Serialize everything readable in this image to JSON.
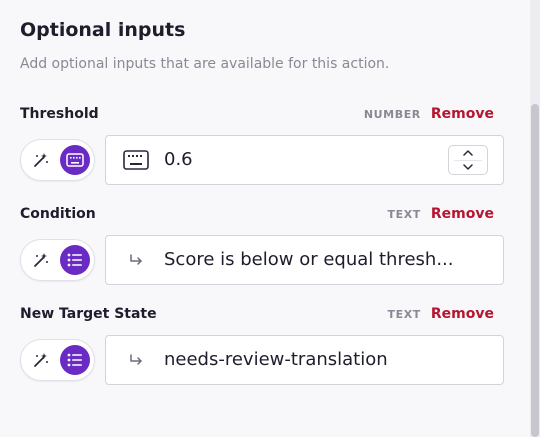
{
  "section": {
    "title": "Optional inputs",
    "subtitle": "Add optional inputs that are available for this action."
  },
  "remove_label": "Remove",
  "fields": [
    {
      "label": "Threshold",
      "type": "NUMBER",
      "value": "0.6",
      "mode_icons": [
        "magic-wand-icon",
        "keyboard-icon"
      ],
      "active_mode": "keyboard",
      "input_icon": "keyboard-icon",
      "has_stepper": true
    },
    {
      "label": "Condition",
      "type": "TEXT",
      "value": "Score is below or equal thresh...",
      "mode_icons": [
        "magic-wand-icon",
        "list-icon"
      ],
      "active_mode": "list",
      "input_icon": "return-arrow-icon"
    },
    {
      "label": "New Target State",
      "type": "TEXT",
      "value": "needs-review-translation",
      "mode_icons": [
        "magic-wand-icon",
        "list-icon"
      ],
      "active_mode": "list",
      "input_icon": "return-arrow-icon"
    }
  ],
  "colors": {
    "accent": "#6a2bc4",
    "remove": "#b3162f",
    "muted": "#8a8894"
  }
}
